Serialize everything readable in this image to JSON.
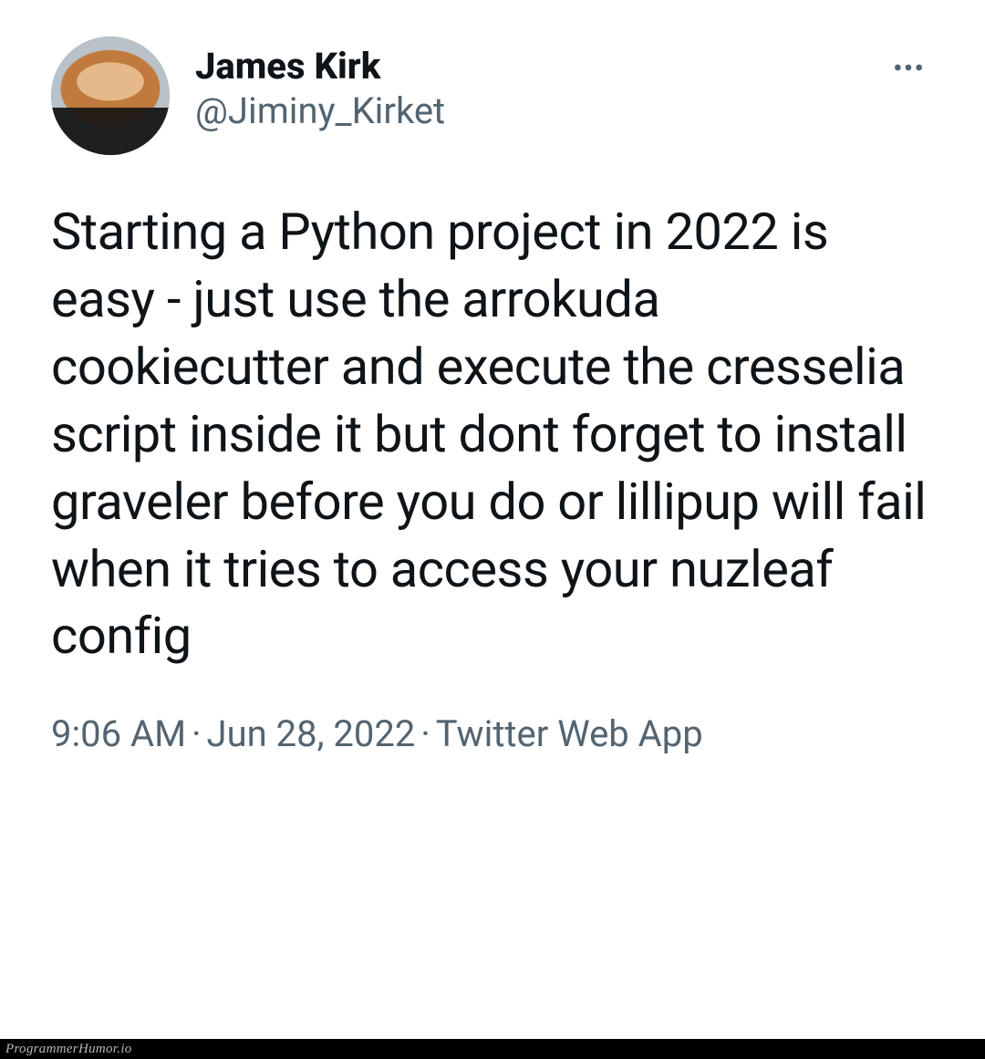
{
  "tweet": {
    "author": {
      "display_name": "James Kirk",
      "handle": "@Jiminy_Kirket"
    },
    "text": "Starting a Python project in 2022 is easy - just use the arrokuda cookiecutter and execute the cresselia script inside it but dont forget to install graveler before you do or lillipup will fail when it tries to access your nuzleaf config",
    "time": "9:06 AM",
    "date": "Jun 28, 2022",
    "source": "Twitter Web App"
  },
  "footer": {
    "watermark": "ProgrammerHumor.io"
  }
}
